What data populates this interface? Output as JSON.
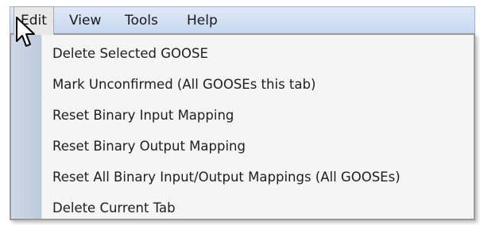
{
  "menubar": {
    "items": [
      {
        "label": "Edit",
        "active": true
      },
      {
        "label": "View",
        "active": false
      },
      {
        "label": "Tools",
        "active": false
      },
      {
        "label": "Help",
        "active": false
      }
    ]
  },
  "edit_menu": {
    "items": [
      "Delete Selected GOOSE",
      "Mark Unconfirmed (All GOOSEs this tab)",
      "Reset Binary Input Mapping",
      "Reset Binary Output Mapping",
      "Reset All Binary Input/Output Mappings (All GOOSEs)",
      "Delete Current Tab"
    ]
  },
  "cursor": {
    "icon": "arrow-pointer-icon"
  },
  "colors": {
    "menubar_bg": "#c8d8f0",
    "dropdown_bg": "#f5f5f5",
    "gutter_bg": "#c5d1e3"
  }
}
